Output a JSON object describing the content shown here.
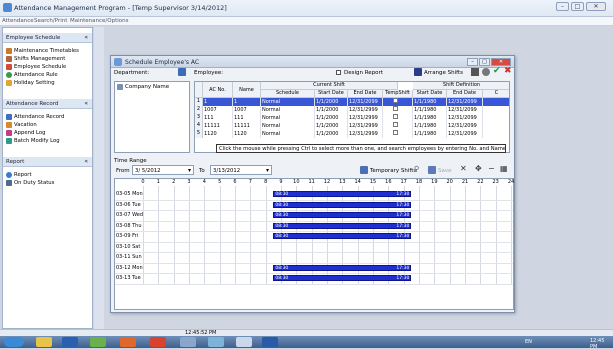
{
  "app": {
    "title": "Attendance Management Program - [Temp Supervisor 3/14/2012]"
  },
  "menu": [
    "Attendance",
    "Search/Print",
    "Maintenance/Options"
  ],
  "sidebar": {
    "sections": [
      {
        "title": "Employee Schedule",
        "items": [
          "Maintenance Timetables",
          "Shifts Management",
          "Employee Schedule",
          "Attendance Rule",
          "Holiday Setting"
        ]
      },
      {
        "title": "Attendance Record",
        "items": [
          "Attendance Record",
          "Vacation",
          "Append Log",
          "Batch Modify Log"
        ]
      },
      {
        "title": "Report",
        "items": [
          "Report",
          "On Duty Status"
        ]
      }
    ],
    "colors": {
      "header": "#dde6f3",
      "accent": "#1f2fd1"
    }
  },
  "dialog": {
    "title": "Schedule Employee's AC",
    "department_label": "Department:",
    "employee_label": "Employee:",
    "company_name": "Company Name",
    "design_report_label": "Design Report",
    "arrange_shifts_label": "Arrange Shifts",
    "grid": {
      "headers": [
        "AC No.",
        "Name",
        "Current Shift",
        "Schedule",
        "Start Date",
        "End Date",
        "TempShift",
        "Shift Definition",
        "Start Date",
        "End Date",
        "C"
      ],
      "rows": [
        [
          "1",
          "1",
          "1",
          "Normal",
          "1/1/2000",
          "12/31/2099",
          "1/1/1980",
          "12/31/2099"
        ],
        [
          "2",
          "1007",
          "1007",
          "Normal",
          "1/1/2000",
          "12/31/2999",
          "1/1/1980",
          "12/31/2099"
        ],
        [
          "3",
          "111",
          "111",
          "Normal",
          "1/1/2000",
          "12/31/2999",
          "1/1/1980",
          "12/31/2099"
        ],
        [
          "4",
          "11111",
          "11111",
          "Normal",
          "1/1/2000",
          "12/31/2999",
          "1/1/1980",
          "12/31/2099"
        ],
        [
          "5",
          "1120",
          "1120",
          "Normal",
          "1/1/2000",
          "12/31/2999",
          "1/1/1980",
          "12/31/2099"
        ]
      ],
      "tooltip": "Click the mouse while pressing Ctrl to select more than one, and search employees by entering No. and Name directly."
    },
    "time_range": {
      "label": "Time Range",
      "from_label": "From",
      "from_value": "3/ 5/2012",
      "to_label": "To",
      "to_value": "3/13/2012",
      "temporary_shifts_label": "Temporary Shifts",
      "save_label": "Save"
    },
    "schedule": {
      "hours": [
        "0",
        "1",
        "2",
        "3",
        "4",
        "5",
        "6",
        "7",
        "8",
        "9",
        "10",
        "11",
        "12",
        "13",
        "14",
        "15",
        "16",
        "17",
        "18",
        "19",
        "20",
        "21",
        "22",
        "23",
        "24"
      ],
      "days": [
        {
          "label": "03-05 Mon",
          "shift": true
        },
        {
          "label": "03-06 Tue",
          "shift": true
        },
        {
          "label": "03-07 Wed",
          "shift": true
        },
        {
          "label": "03-08 Thu",
          "shift": true
        },
        {
          "label": "03-09 Fri",
          "shift": true
        },
        {
          "label": "03-10 Sat",
          "shift": false
        },
        {
          "label": "03-11 Sun",
          "shift": false
        },
        {
          "label": "03-12 Mon",
          "shift": true
        },
        {
          "label": "03-13 Tue",
          "shift": true
        }
      ],
      "shift_start": "08:30",
      "shift_end": "17:30",
      "start_hour": 8.5,
      "end_hour": 17.5
    }
  },
  "statusbar": {
    "time": "12:45:52 PM"
  },
  "taskbar": {
    "clock": "12:45 PM",
    "lang": "EN"
  }
}
